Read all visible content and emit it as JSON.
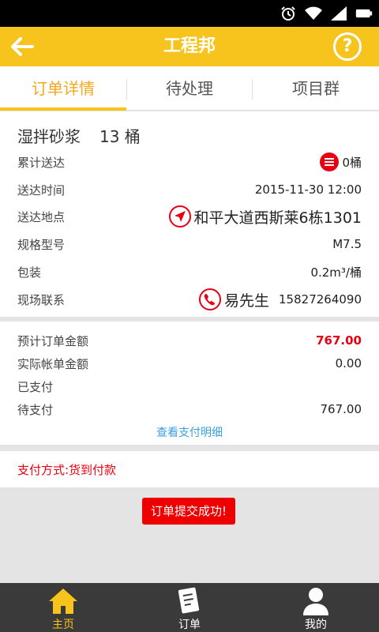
{
  "status_bar": {
    "icons": [
      "alarm-icon",
      "wifi-icon",
      "signal-icon",
      "battery-icon"
    ]
  },
  "header": {
    "title": "工程邦",
    "back_icon": "back-arrow-icon",
    "help_label": "?"
  },
  "tabs": [
    {
      "label": "订单详情",
      "active": true
    },
    {
      "label": "待处理",
      "active": false
    },
    {
      "label": "项目群",
      "active": false
    }
  ],
  "order": {
    "product": "湿拌砂浆",
    "quantity": "13 桶",
    "rows": [
      {
        "label": "累计送达",
        "value": "0桶",
        "icon": "list-icon"
      },
      {
        "label": "送达时间",
        "value": "2015-11-30 12:00"
      },
      {
        "label": "送达地点",
        "value": "和平大道西斯莱6栋1301",
        "icon": "location-arrow-icon"
      },
      {
        "label": "规格型号",
        "value": "M7.5"
      },
      {
        "label": "包装",
        "value": "0.2m³/桶"
      },
      {
        "label": "现场联系",
        "name": "易先生",
        "phone": "15827264090",
        "icon": "phone-icon"
      }
    ]
  },
  "payment": {
    "rows": [
      {
        "label": "预计订单金额",
        "value": "767.00",
        "highlight": true
      },
      {
        "label": "实际帐单金额",
        "value": "0.00"
      },
      {
        "label": "已支付",
        "value": ""
      },
      {
        "label": "待支付",
        "value": "767.00"
      }
    ],
    "detail_link": "查看支付明细"
  },
  "pay_method": "支付方式:货到付款",
  "toast": "订单提交成功!",
  "bottom_nav": [
    {
      "label": "主页",
      "icon": "home-icon",
      "active": true
    },
    {
      "label": "订单",
      "icon": "order-icon",
      "active": false
    },
    {
      "label": "我的",
      "icon": "user-icon",
      "active": false
    }
  ],
  "colors": {
    "accent": "#f7c31d",
    "red": "#e60012",
    "link": "#3aa0e0",
    "nav_bg": "#3a3a3a"
  }
}
